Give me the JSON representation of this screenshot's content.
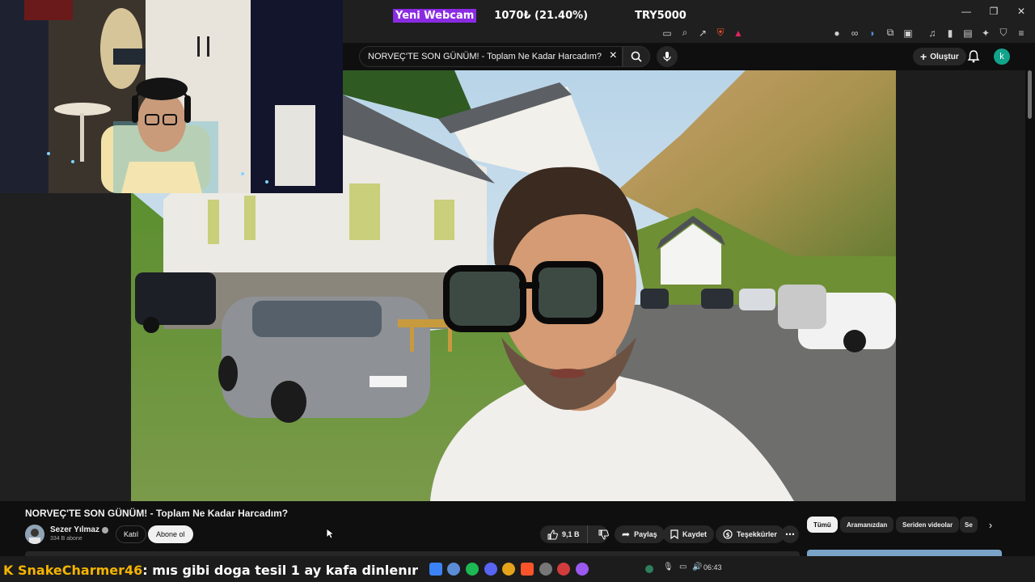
{
  "overlay": {
    "webcam_label": "Yeni Webcam",
    "goal_current": "1070₺ (21.40%)",
    "goal_target": "TRY5000"
  },
  "search": {
    "value": "NORVEÇ'TE SON GÜNÜM! - Toplam Ne Kadar Harcadım?"
  },
  "masthead": {
    "create_label": "Oluştur",
    "avatar_letter": "k"
  },
  "video": {
    "title": "NORVEÇ'TE SON GÜNÜM! - Toplam Ne Kadar Harcadım?",
    "channel_name": "Sezer Yılmaz",
    "subscribers": "334 B abone",
    "join_label": "Katıl",
    "subscribe_label": "Abone ol",
    "likes": "9,1 B",
    "share_label": "Paylaş",
    "save_label": "Kaydet",
    "thanks_label": "Teşekkürler"
  },
  "chips": [
    {
      "label": "Tümü",
      "active": true
    },
    {
      "label": "Aramanızdan",
      "active": false
    },
    {
      "label": "Seriden videolar",
      "active": false
    },
    {
      "label": "Se",
      "active": false
    }
  ],
  "chat": {
    "user": "SnakeCharmer46",
    "message": "mıs gibi doga tesil 1 ay kafa dinlenır"
  },
  "taskbar": {
    "time": "06:43"
  },
  "colors": {
    "accent_purple": "#8a2be2",
    "yt_avatar": "#12a38b",
    "chat_user": "#f5b400",
    "background": "#0f0f0f"
  }
}
